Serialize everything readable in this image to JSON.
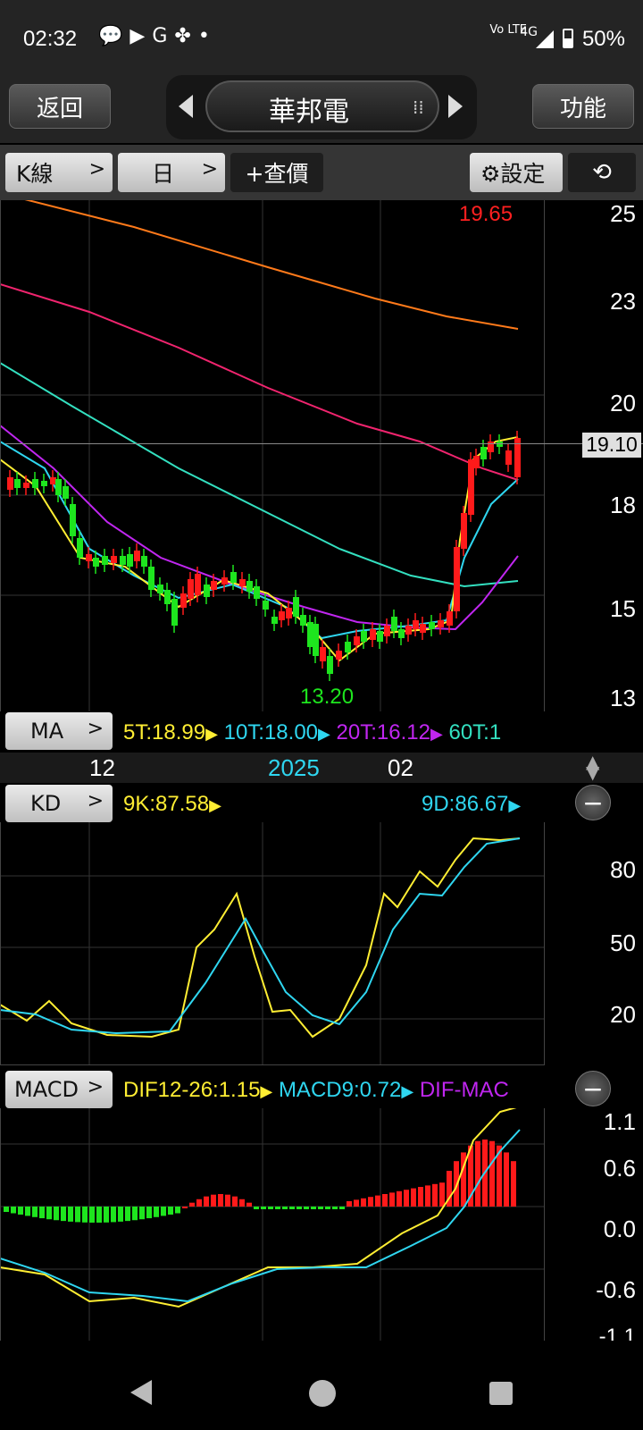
{
  "status_bar": {
    "time": "02:32",
    "notification_icons": [
      "chat-bubble-icon",
      "youtube-icon",
      "google-icon",
      "pinwheel-icon",
      "dot-icon"
    ],
    "network_label": "Vo LTE",
    "network_type": "4G",
    "battery": "50%"
  },
  "nav": {
    "back_label": "返回",
    "title": "華邦電",
    "func_label": "功能"
  },
  "toolbar": {
    "kline_label": "K線",
    "period_label": "日",
    "query_label": "+查價",
    "settings_label": "⚙設定"
  },
  "price_chart": {
    "axis_labels": [
      "25",
      "23",
      "20",
      "18",
      "15",
      "13"
    ],
    "high_marker": "19.65",
    "low_marker": "13.20",
    "current_price": "19.10",
    "ma_button": "MA",
    "ma_legend": [
      "5T:18.99",
      "10T:18.00",
      "20T:16.12",
      "60T:1"
    ],
    "x_labels": [
      "12",
      "2025",
      "02"
    ]
  },
  "kd_chart": {
    "button": "KD",
    "k_legend": "9K:87.58",
    "d_legend": "9D:86.67",
    "axis_labels": [
      "80",
      "50",
      "20"
    ]
  },
  "macd_chart": {
    "button": "MACD",
    "legend": [
      "DIF12-26:1.15",
      "MACD9:0.72",
      "DIF-MAC"
    ],
    "axis_labels": [
      "1.1",
      "0.6",
      "0.0",
      "-0.6",
      "-1.1"
    ]
  },
  "colors": {
    "up": "#ff1a1a",
    "down": "#1ee51e",
    "ma5": "#ffee33",
    "ma10": "#2fd6f0",
    "ma20": "#c026f0",
    "ma60": "#33e0c0",
    "ma_orange": "#ff7a1a",
    "ma_pink": "#f0246e"
  }
}
